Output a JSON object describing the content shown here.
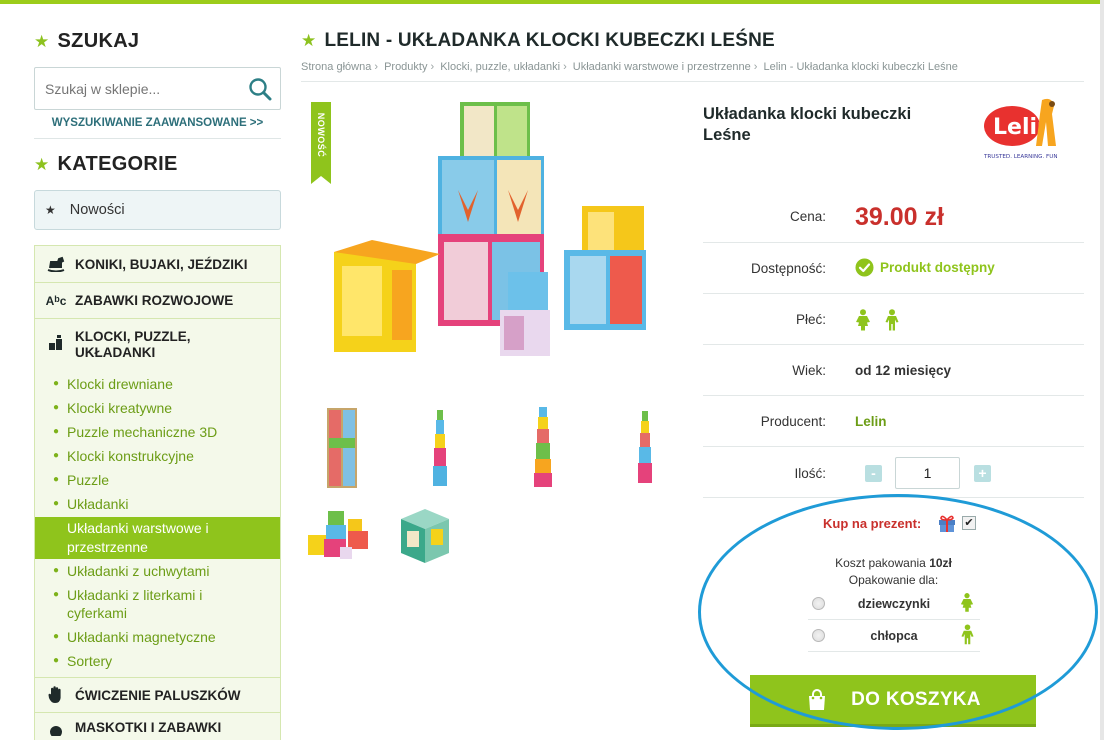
{
  "sidebar": {
    "search_title": "SZUKAJ",
    "search_placeholder": "Szukaj w sklepie...",
    "advanced_search": "WYSZUKIWANIE ZAAWANSOWANE >>",
    "categories_title": "KATEGORIE",
    "novelty": "Nowości",
    "categories": [
      {
        "label": "KONIKI, BUJAKI, JEŹDZIKI",
        "icon": "rocking-horse-icon"
      },
      {
        "label": "ZABAWKI ROZWOJOWE",
        "icon": "abc-icon"
      },
      {
        "label": "KLOCKI, PUZZLE, UKŁADANKI",
        "icon": "blocks-icon"
      },
      {
        "label": "ĆWICZENIE PALUSZKÓW",
        "icon": "hand-icon"
      },
      {
        "label": "MASKOTKI I ZABAWKI",
        "icon": "mascot-icon"
      }
    ],
    "subcategories": [
      "Klocki drewniane",
      "Klocki kreatywne",
      "Puzzle mechaniczne 3D",
      "Klocki konstrukcyjne",
      "Puzzle",
      "Układanki",
      "Układanki warstwowe i przestrzenne",
      "Układanki z uchwytami",
      "Układanki z literkami i cyferkami",
      "Układanki magnetyczne",
      "Sortery"
    ]
  },
  "page": {
    "title": "LELIN - UKŁADANKA KLOCKI KUBECZKI LEŚNE",
    "breadcrumb": [
      "Strona główna",
      "Produkty",
      "Klocki, puzzle, układanki",
      "Układanki warstwowe i przestrzenne",
      "Lelin - Układanka klocki kubeczki Leśne"
    ],
    "new_badge": "NOWOŚĆ"
  },
  "product": {
    "name": "Układanka klocki kubeczki Leśne",
    "brand_logo_text": "Lelin",
    "brand_tagline": "TRUSTED. LEARNING. FUN",
    "price_label": "Cena:",
    "price": "39.00 zł",
    "availability_label": "Dostępność:",
    "availability": "Produkt dostępny",
    "gender_label": "Płeć:",
    "age_label": "Wiek:",
    "age": "od 12 miesięcy",
    "producer_label": "Producent:",
    "producer": "Lelin",
    "qty_label": "Ilość:",
    "qty_minus": "-",
    "qty_value": "1",
    "qty_plus": "+"
  },
  "gift": {
    "label": "Kup na prezent:",
    "checked": true,
    "check_glyph": "✔",
    "cost_prefix": "Koszt pakowania",
    "cost_value": "10zł",
    "for_label": "Opakowanie dla:",
    "options": [
      "dziewczynki",
      "chłopca"
    ]
  },
  "cart": {
    "button_label": "DO KOSZYKA"
  },
  "colors": {
    "brand_green": "#8fc41c",
    "price_red": "#c9302c",
    "annotation_blue": "#1f9bd7"
  }
}
